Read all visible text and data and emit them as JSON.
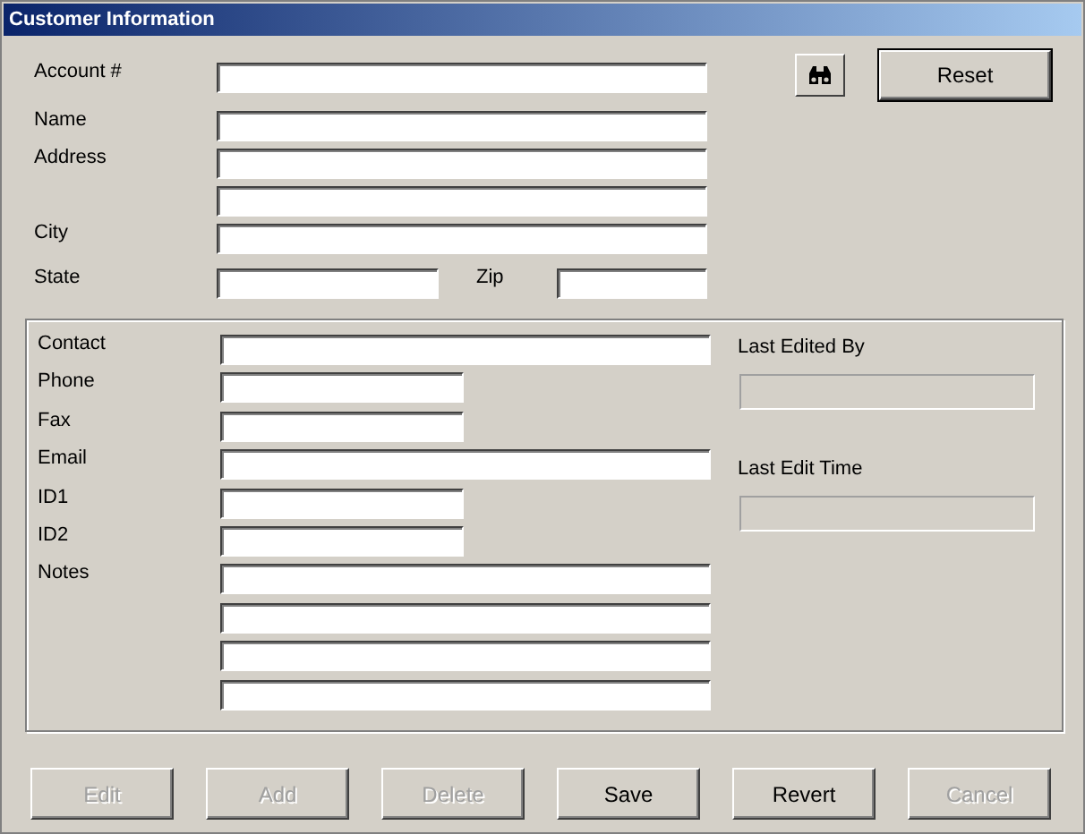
{
  "window": {
    "title": "Customer Information"
  },
  "top_fields": [
    {
      "label": "Account #",
      "kind": "wide"
    },
    {
      "label": "Name",
      "kind": "wide"
    },
    {
      "label": "Address",
      "kind": "wide"
    },
    {
      "kind": "wide"
    },
    {
      "label": "City",
      "kind": "wide"
    }
  ],
  "state_zip": {
    "state_label": "State",
    "zip_label": "Zip"
  },
  "reset_button": {
    "label": "Reset"
  },
  "details": [
    {
      "label": "Contact",
      "kind": "wide"
    },
    {
      "label": "Phone",
      "kind": "short"
    },
    {
      "label": "Fax",
      "kind": "short"
    },
    {
      "label": "Email",
      "kind": "wide"
    },
    {
      "label": "ID1",
      "kind": "short"
    },
    {
      "label": "ID2",
      "kind": "short"
    },
    {
      "label": "Notes",
      "kind": "wide"
    },
    {
      "kind": "wide"
    },
    {
      "kind": "wide"
    },
    {
      "kind": "wide"
    }
  ],
  "audit": [
    {
      "label": "Last Edited By",
      "disabled": true
    },
    {
      "label": "Last Edit Time",
      "disabled": true
    }
  ],
  "buttons": [
    {
      "label": "Edit",
      "disabled": true
    },
    {
      "label": "Add",
      "disabled": true
    },
    {
      "label": "Delete",
      "disabled": true
    },
    {
      "label": "Save",
      "disabled": false
    },
    {
      "label": "Revert",
      "disabled": false
    },
    {
      "label": "Cancel",
      "disabled": true
    }
  ]
}
